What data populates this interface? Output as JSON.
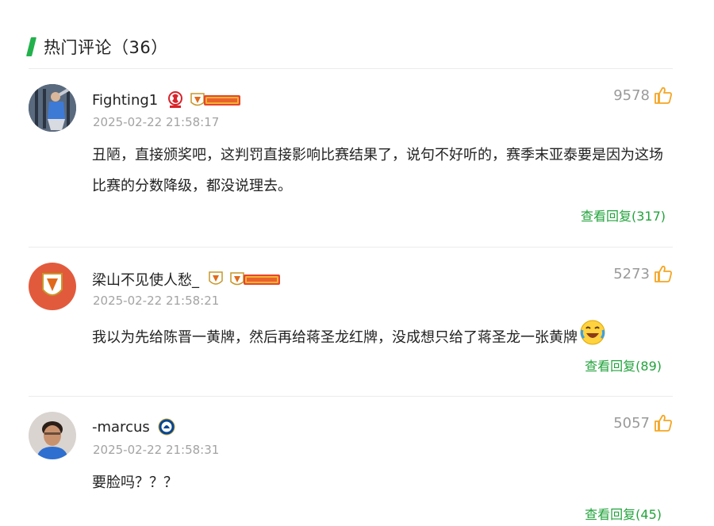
{
  "header": {
    "title": "热门评论（36）"
  },
  "comments": [
    {
      "username": "Fighting1",
      "timestamp": "2025-02-22 21:58:17",
      "likes": "9578",
      "text": "丑陋，直接颁奖吧，这判罚直接影响比赛结果了，说句不好听的，赛季末亚泰要是因为这场比赛的分数降级，都没说理去。",
      "replies": "查看回复(317)",
      "badges": [
        "red-team-badge-icon",
        "fan-rank-badge-icon"
      ]
    },
    {
      "username": "梁山不见使人愁_",
      "timestamp": "2025-02-22 21:58:21",
      "likes": "5273",
      "text": "我以为先给陈晋一黄牌，然后再给蒋圣龙红牌，没成想只给了蒋圣龙一张黄牌",
      "replies": "查看回复(89)",
      "badges": [
        "shield-team-badge-icon",
        "fan-rank-badge-icon"
      ],
      "emoji": "laughing-crying-emoji"
    },
    {
      "username": "-marcus",
      "timestamp": "2025-02-22 21:58:31",
      "likes": "5057",
      "text": "要脸吗？？？",
      "replies": "查看回复(45)",
      "badges": [
        "chelsea-badge-icon"
      ]
    }
  ],
  "colors": {
    "accent": "#22b14c",
    "reply": "#22a33c",
    "thumb": "#f5a623",
    "muted": "#a3a3a3"
  }
}
